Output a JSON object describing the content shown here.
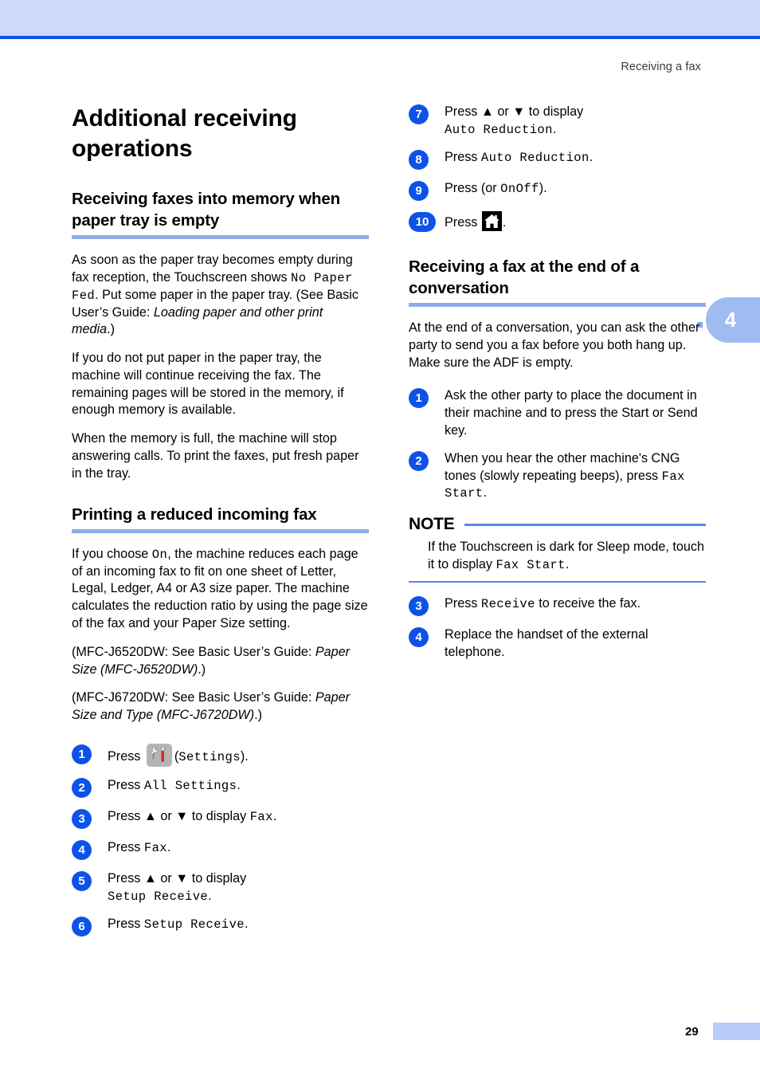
{
  "page": {
    "running_head": "Receiving a fax",
    "chapter_tab": "4",
    "page_number": "29",
    "accent_banner": "#cdd9fb",
    "accent_rule": "#0d52e8",
    "heading_rule": "#8fabe8",
    "badge_color": "#0d52e8"
  },
  "left_column": {
    "chapter_title": "Additional receiving operations",
    "section1": {
      "title": "Receiving faxes into memory when paper tray is empty",
      "p1_a": "As soon as the paper tray becomes empty during fax reception, the Touchscreen shows ",
      "p1_mono": "No Paper Fed",
      "p1_b": ". Put some paper in the paper tray. (See Basic User’s Guide: ",
      "p1_ital": "Loading paper and other print media",
      "p1_c": ".)",
      "p2": "If you do not put paper in the paper tray, the machine will continue receiving the fax. The remaining pages will be stored in the memory, if enough memory is available.",
      "p3": "When the memory is full, the machine will stop answering calls. To print the faxes, put fresh paper in the tray."
    },
    "section2": {
      "title": "Printing a reduced incoming fax",
      "p1_a": "If you choose ",
      "p1_mono": "On",
      "p1_b": ", the machine reduces each page of an incoming fax to fit on one sheet of Letter, Legal, Ledger, A4 or A3 size paper. The machine calculates the reduction ratio by using the page size of the fax and your Paper Size setting.",
      "p2_a": "(MFC-J6520DW: See Basic User’s Guide: ",
      "p2_ital": "Paper Size (MFC-J6520DW)",
      "p2_b": ".)",
      "p3_a": "(MFC-J6720DW: See Basic User’s Guide: ",
      "p3_ital": "Paper Size and Type (MFC-J6720DW)",
      "p3_b": ".)",
      "steps": [
        {
          "num": "1",
          "pre": "Press ",
          "icon": "settings-icon",
          "mid": "(",
          "mono": "Settings",
          "post": ")."
        },
        {
          "num": "2",
          "pre": "Press ",
          "mono": "All Settings",
          "post": "."
        },
        {
          "num": "3",
          "pre": "Press ▲ or ▼ to display ",
          "mono": "Fax",
          "post": "."
        },
        {
          "num": "4",
          "pre": "Press ",
          "mono": "Fax",
          "post": "."
        },
        {
          "num": "5",
          "pre": "Press ▲ or ▼ to display",
          "mono": "Setup Receive",
          "post": ".",
          "break_before_mono": true
        },
        {
          "num": "6",
          "pre": "Press ",
          "mono": "Setup Receive",
          "post": "."
        }
      ]
    }
  },
  "right_column": {
    "steps_continued": [
      {
        "num": "7",
        "pre": "Press ▲ or ▼ to display",
        "mono": "Auto Reduction",
        "post": ".",
        "break_before_mono": true
      },
      {
        "num": "8",
        "pre": "Press ",
        "mono": "Auto Reduction",
        "post": "."
      },
      {
        "num": "9",
        "pre": "Press ",
        "mono": "On",
        "mid": " (or ",
        "mono2": "Off",
        "post": ")."
      },
      {
        "num": "10",
        "pre": "Press ",
        "icon": "home-icon",
        "post": "."
      }
    ],
    "section3": {
      "title": "Receiving a fax at the end of a conversation",
      "p1": "At the end of a conversation, you can ask the other party to send you a fax before you both hang up. Make sure the ADF is empty.",
      "steps_a": [
        {
          "num": "1",
          "pre": "Ask the other party to place the document in their machine and to press the Start or Send key."
        },
        {
          "num": "2",
          "pre": "When you hear the other machine's CNG tones (slowly repeating beeps), press ",
          "mono": "Fax Start",
          "post": "."
        }
      ],
      "note": {
        "label": "NOTE",
        "text_a": "If the Touchscreen is dark for Sleep mode, touch it to display ",
        "mono": "Fax Start",
        "text_b": "."
      },
      "steps_b": [
        {
          "num": "3",
          "pre": "Press ",
          "mono": "Receive",
          "post": " to receive the fax."
        },
        {
          "num": "4",
          "pre": "Replace the handset of the external telephone."
        }
      ]
    }
  }
}
